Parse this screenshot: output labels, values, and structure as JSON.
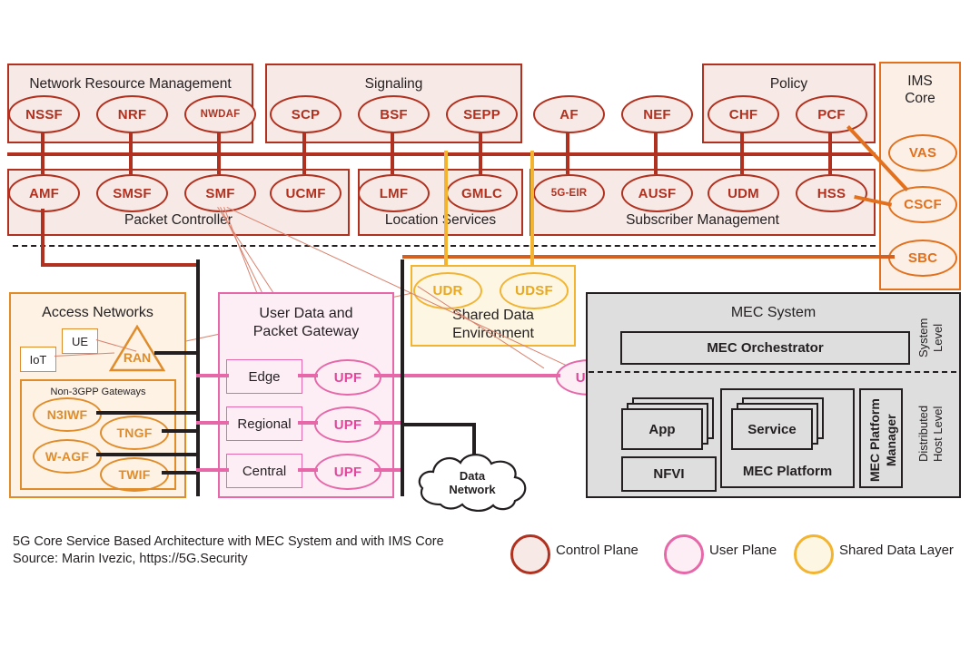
{
  "diagram": {
    "caption_line1": "5G Core Service Based Architecture with MEC System and with IMS Core",
    "caption_line2": "Source: Marin Ivezic, https://5G.Security"
  },
  "colors": {
    "control_plane": "#b0311f",
    "control_plane_fill": "#f7e9e6",
    "user_plane": "#e668a8",
    "user_plane_fill": "#fdeef6",
    "shared_data": "#f2b431",
    "shared_data_fill": "#fdf6e3",
    "ims": "#e2701d",
    "access": "#e08c2a",
    "black": "#231f20",
    "mec_fill": "#dedede"
  },
  "control_plane": {
    "groups": [
      {
        "label": "Network Resource Management"
      },
      {
        "label": "Signaling"
      },
      {
        "label": "Policy"
      },
      {
        "label": "Packet Controller"
      },
      {
        "label": "Location Services"
      },
      {
        "label": "Subscriber Management"
      }
    ],
    "top_row": [
      {
        "label": "NSSF"
      },
      {
        "label": "NRF"
      },
      {
        "label": "NWDAF"
      },
      {
        "label": "SCP"
      },
      {
        "label": "BSF"
      },
      {
        "label": "SEPP"
      },
      {
        "label": "AF"
      },
      {
        "label": "NEF"
      },
      {
        "label": "CHF"
      },
      {
        "label": "PCF"
      }
    ],
    "bottom_row": [
      {
        "label": "AMF"
      },
      {
        "label": "SMSF"
      },
      {
        "label": "SMF"
      },
      {
        "label": "UCMF"
      },
      {
        "label": "LMF"
      },
      {
        "label": "GMLC"
      },
      {
        "label": "5G-EIR"
      },
      {
        "label": "AUSF"
      },
      {
        "label": "UDM"
      },
      {
        "label": "HSS"
      }
    ]
  },
  "ims_core": {
    "title_line1": "IMS",
    "title_line2": "Core",
    "nodes": [
      {
        "label": "VAS"
      },
      {
        "label": "CSCF"
      },
      {
        "label": "SBC"
      }
    ]
  },
  "shared_data_environment": {
    "title_line1": "Shared Data",
    "title_line2": "Environment",
    "nodes": [
      {
        "label": "UDR"
      },
      {
        "label": "UDSF"
      }
    ]
  },
  "access_networks": {
    "title": "Access Networks",
    "subgroup_title": "Non-3GPP Gateways",
    "boxes": [
      {
        "label": "IoT"
      },
      {
        "label": "UE"
      }
    ],
    "ran": {
      "label": "RAN"
    },
    "gateways": [
      {
        "label": "N3IWF"
      },
      {
        "label": "TNGF"
      },
      {
        "label": "W-AGF"
      },
      {
        "label": "TWIF"
      }
    ]
  },
  "user_data_gateway": {
    "title_line1": "User Data and",
    "title_line2": "Packet Gateway",
    "tiers": [
      {
        "label": "Edge"
      },
      {
        "label": "Regional"
      },
      {
        "label": "Central"
      }
    ],
    "upfs": [
      {
        "label": "UPF"
      },
      {
        "label": "UPF"
      },
      {
        "label": "UPF"
      },
      {
        "label": "UPF"
      }
    ]
  },
  "data_network": {
    "line1": "Data",
    "line2": "Network"
  },
  "mec_system": {
    "title": "MEC System",
    "orchestrator": "MEC Orchestrator",
    "system_level_line1": "System",
    "system_level_line2": "Level",
    "host_level_line1": "Distributed",
    "host_level_line2": "Host Level",
    "app": "App",
    "service": "Service",
    "nfvi": "NFVI",
    "platform": "MEC Platform",
    "platform_manager_line1": "MEC Platform",
    "platform_manager_line2": "Manager"
  },
  "legend": {
    "items": [
      {
        "label": "Control Plane",
        "color": "#b0311f",
        "fill": "#f7e9e6"
      },
      {
        "label": "User Plane",
        "color": "#e668a8",
        "fill": "#fdeef6"
      },
      {
        "label": "Shared Data Layer",
        "color": "#f2b431",
        "fill": "#fdf6e3"
      }
    ]
  }
}
